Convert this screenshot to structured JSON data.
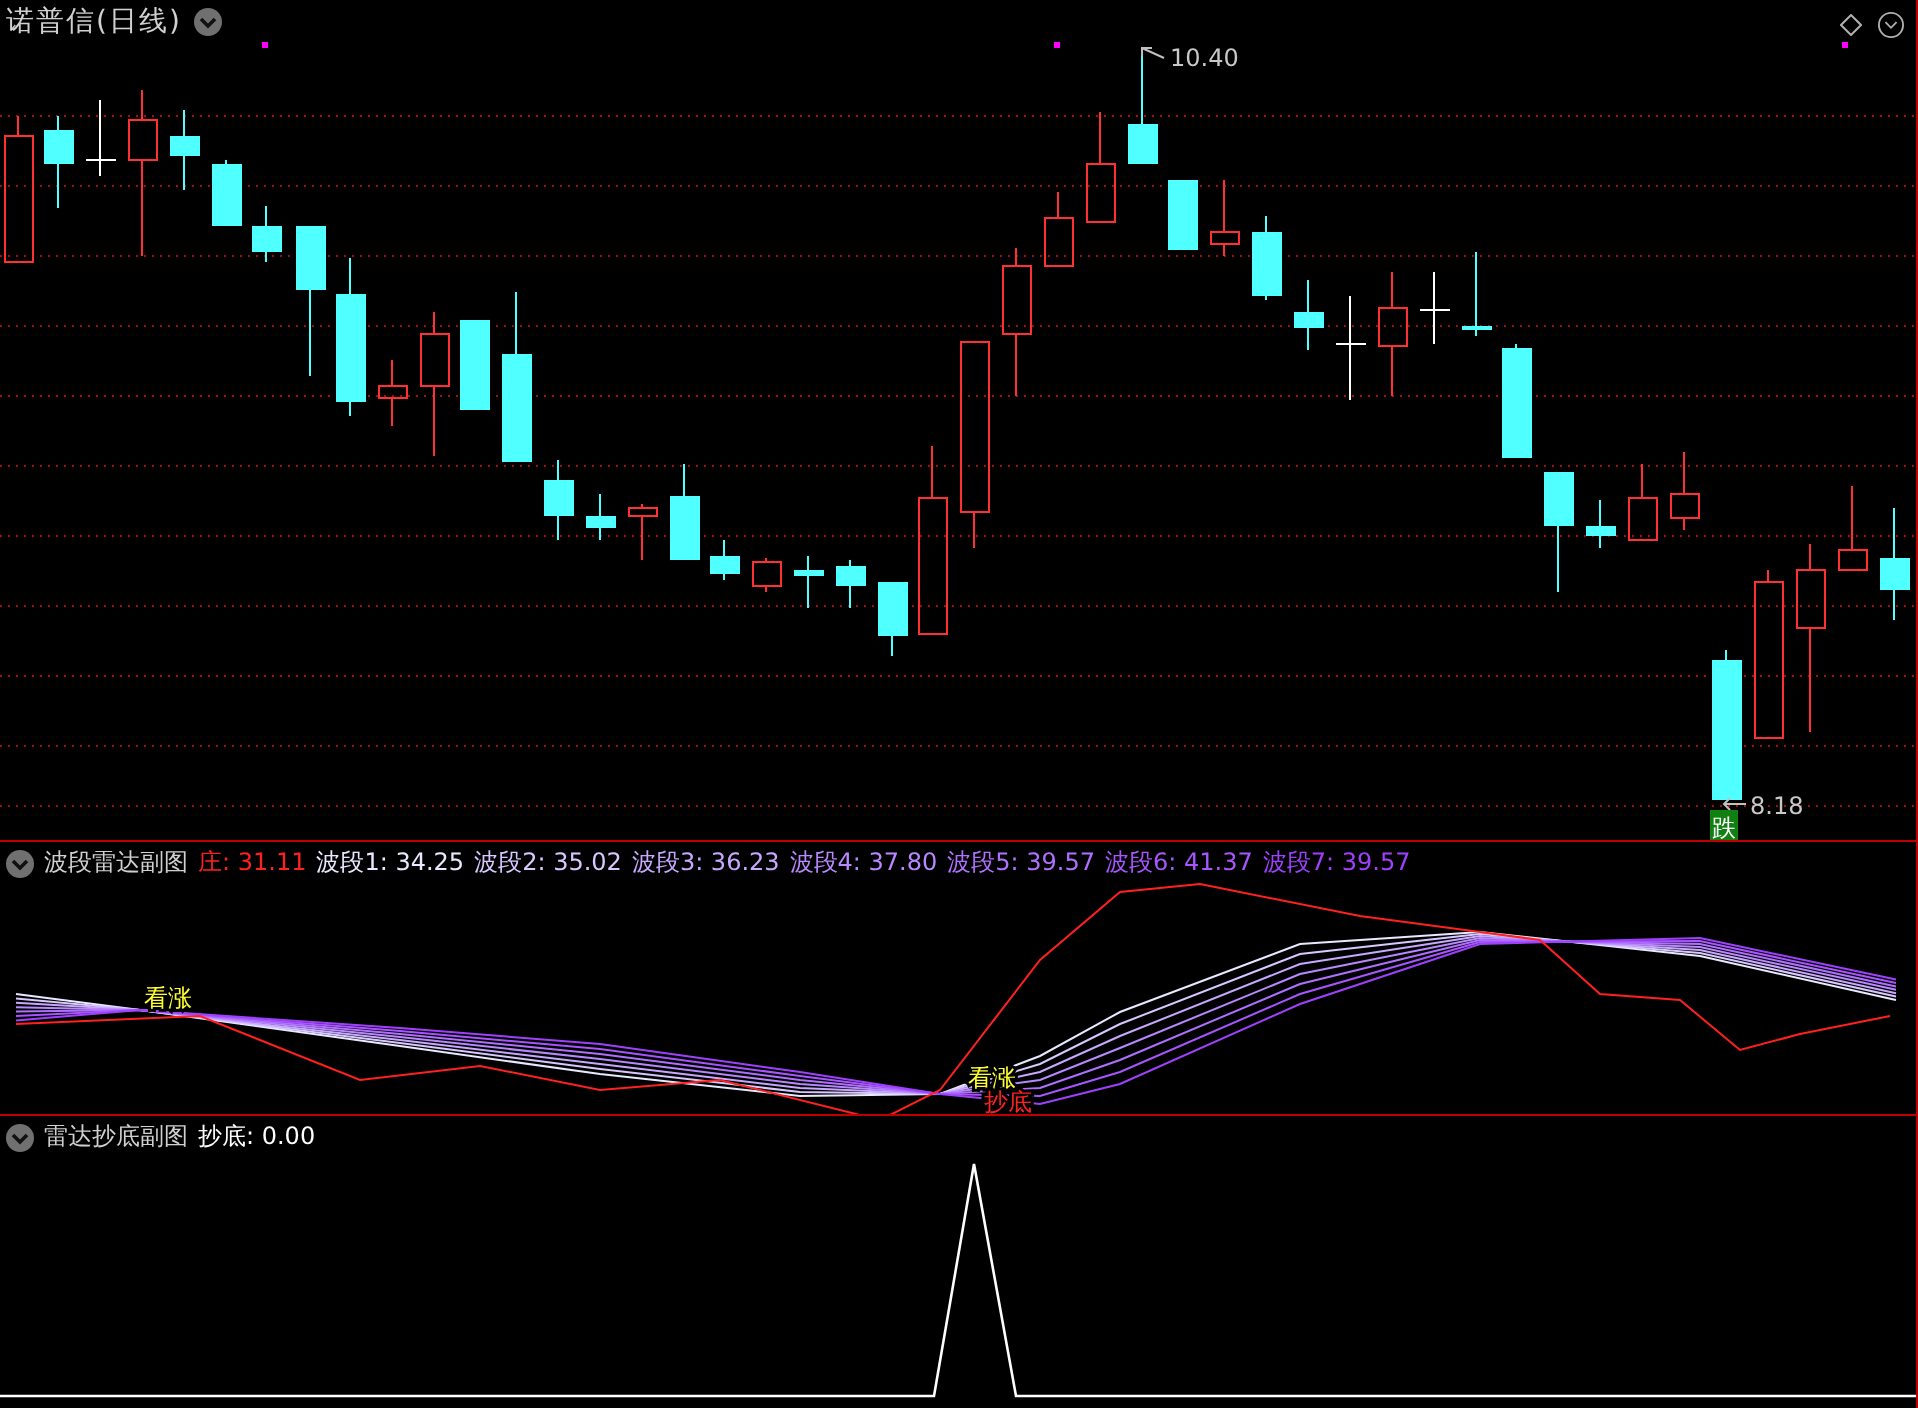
{
  "chart": {
    "title": "诺普信(日线)",
    "high_label": "10.40",
    "low_label": "8.18",
    "low_badge": "跌"
  },
  "band_radar": {
    "title": "波段雷达副图",
    "legend": [
      {
        "label": "庄: 31.11",
        "color": "#ff2020"
      },
      {
        "label": "波段1: 34.25",
        "color": "#e8e8ff"
      },
      {
        "label": "波段2: 35.02",
        "color": "#d8c8ff"
      },
      {
        "label": "波段3: 36.23",
        "color": "#c8a8ff"
      },
      {
        "label": "波段4: 37.80",
        "color": "#b888ff"
      },
      {
        "label": "波段5: 39.57",
        "color": "#b070ff"
      },
      {
        "label": "波段6: 41.37",
        "color": "#a855ff"
      },
      {
        "label": "波段7: 39.57",
        "color": "#a040ff"
      }
    ],
    "signals": [
      {
        "text": "看涨",
        "kind": "rise"
      },
      {
        "text": "看涨",
        "kind": "rise"
      },
      {
        "text": "抄底",
        "kind": "bottom"
      }
    ]
  },
  "bottom_radar": {
    "title": "雷达抄底副图",
    "reading": "抄底: 0.00"
  }
}
